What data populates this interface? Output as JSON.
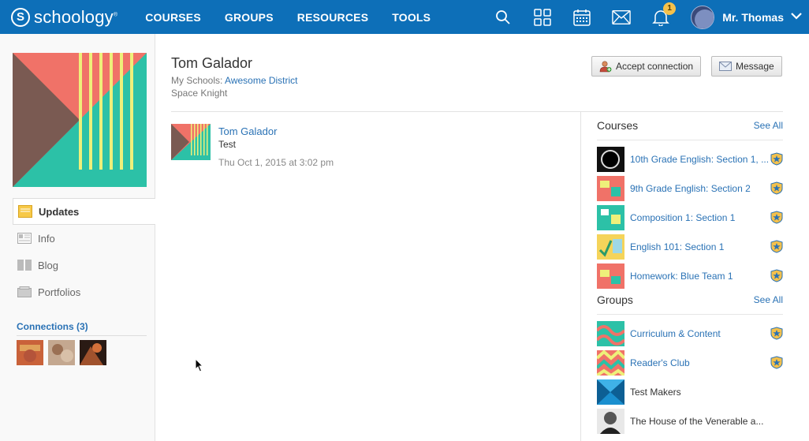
{
  "brand": {
    "name": "schoology",
    "mark": "S",
    "tm": "®"
  },
  "nav": {
    "courses": "COURSES",
    "groups": "GROUPS",
    "resources": "RESOURCES",
    "tools": "TOOLS"
  },
  "header_icons": [
    "search-icon",
    "apps-grid-icon",
    "calendar-icon",
    "messages-icon",
    "notifications-icon"
  ],
  "notifications_count": "1",
  "user": {
    "name": "Mr. Thomas"
  },
  "profile": {
    "name": "Tom Galador",
    "schools_label": "My Schools:",
    "school": "Awesome District",
    "role": "Space Knight",
    "accept_label": "Accept connection",
    "message_label": "Message"
  },
  "side_nav": {
    "updates": "Updates",
    "info": "Info",
    "blog": "Blog",
    "portfolios": "Portfolios"
  },
  "connections": {
    "title": "Connections (3)"
  },
  "feed": [
    {
      "author": "Tom Galador",
      "text": "Test",
      "time": "Thu Oct 1, 2015 at 3:02 pm"
    }
  ],
  "courses": {
    "title": "Courses",
    "see_all": "See All",
    "items": [
      {
        "label": "10th Grade English: Section 1, ..."
      },
      {
        "label": "9th Grade English: Section 2"
      },
      {
        "label": "Composition 1: Section 1"
      },
      {
        "label": "English 101: Section 1"
      },
      {
        "label": "Homework: Blue Team 1"
      }
    ]
  },
  "groups": {
    "title": "Groups",
    "see_all": "See All",
    "items": [
      {
        "label": "Curriculum & Content"
      },
      {
        "label": "Reader's Club"
      },
      {
        "label": "Test Makers"
      },
      {
        "label": "The House of the Venerable a..."
      }
    ]
  },
  "colors": {
    "nav_bg": "#0d6fb8",
    "link": "#2a72b5",
    "badge": "#f5c14b"
  }
}
